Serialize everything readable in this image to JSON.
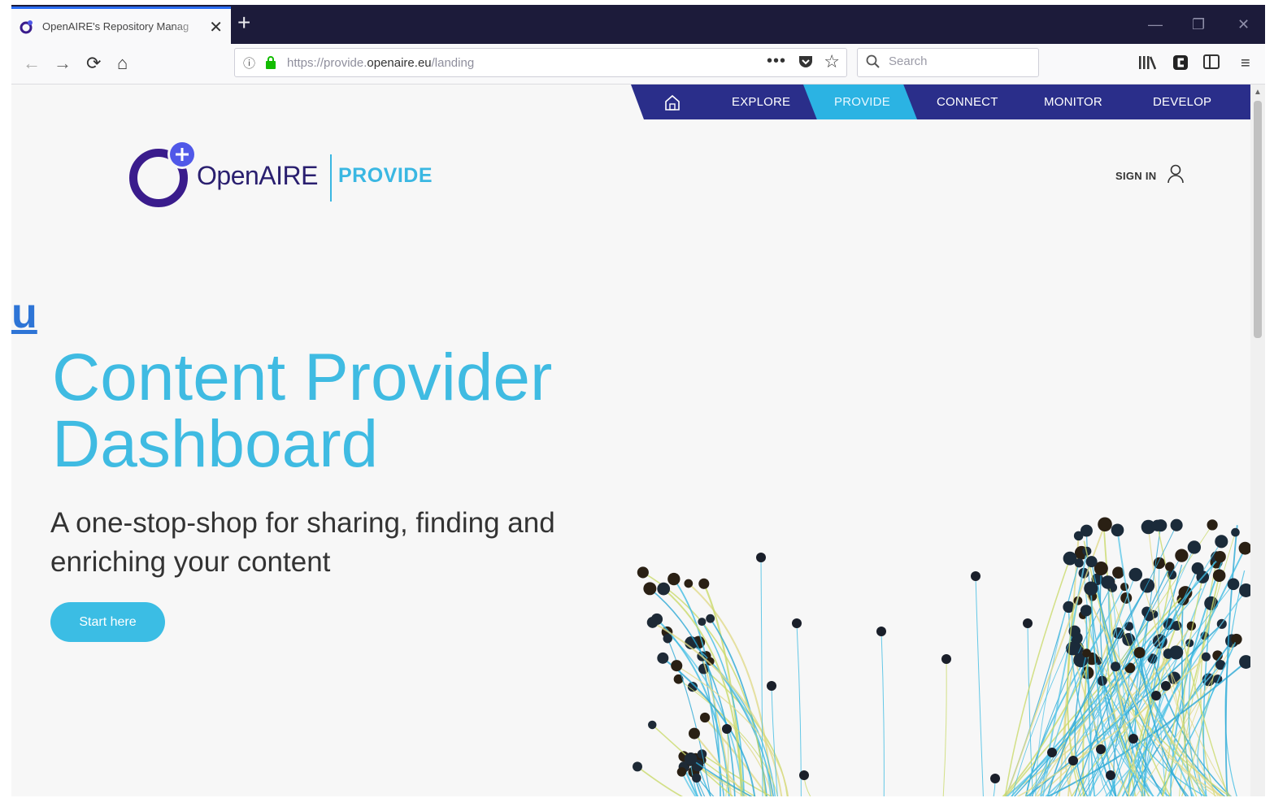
{
  "browser": {
    "tab_title": "OpenAIRE's Repository Manag",
    "url_prefix": "https://provide.",
    "url_host": "openaire.eu",
    "url_path": "/landing",
    "search_placeholder": "Search",
    "more_glyph": "•••"
  },
  "site_nav": {
    "items": [
      {
        "label": "EXPLORE"
      },
      {
        "label": "PROVIDE",
        "active": true
      },
      {
        "label": "CONNECT"
      },
      {
        "label": "MONITOR"
      },
      {
        "label": "DEVELOP"
      }
    ]
  },
  "logo": {
    "wordmark": "OpenAIRE",
    "product": "PROVIDE"
  },
  "header": {
    "sign_in_label": "SIGN IN"
  },
  "left_fragment": "u",
  "hero": {
    "title_line1": "Content Provider",
    "title_line2": "Dashboard",
    "subtitle": "A one-stop-shop for sharing, finding and enriching your content",
    "cta_label": "Start here"
  },
  "colors": {
    "nav_bg": "#2a2e8a",
    "accent_cyan": "#3bbde4",
    "logo_purple": "#3a1c8c",
    "page_bg": "#f7f7f7"
  }
}
